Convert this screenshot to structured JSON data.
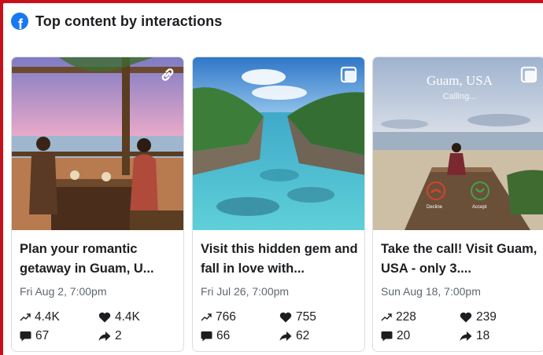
{
  "header": {
    "icon": "facebook-icon",
    "title": "Top content by interactions"
  },
  "colors": {
    "background": "#c8101a",
    "facebook_blue": "#1877f2",
    "text": "#1c1e21",
    "muted": "#606770"
  },
  "cards": [
    {
      "media_icon": "link-icon",
      "caption": "Plan your romantic getaway in Guam, U...",
      "date": "Fri Aug 2, 7:00pm",
      "reach": "4.4K",
      "reactions": "4.4K",
      "comments": "67",
      "shares": "2"
    },
    {
      "media_icon": "photo-icon",
      "caption": "Visit this hidden gem and fall in love with...",
      "date": "Fri Jul 26, 7:00pm",
      "reach": "766",
      "reactions": "755",
      "comments": "66",
      "shares": "62"
    },
    {
      "media_icon": "photo-icon",
      "caption": "Take the call! Visit Guam, USA - only 3....",
      "date": "Sun Aug 18, 7:00pm",
      "reach": "228",
      "reactions": "239",
      "comments": "20",
      "shares": "18",
      "image_text": {
        "title": "Guam, USA",
        "subtitle": "Calling...",
        "decline": "Decline",
        "accept": "Accept"
      }
    }
  ]
}
